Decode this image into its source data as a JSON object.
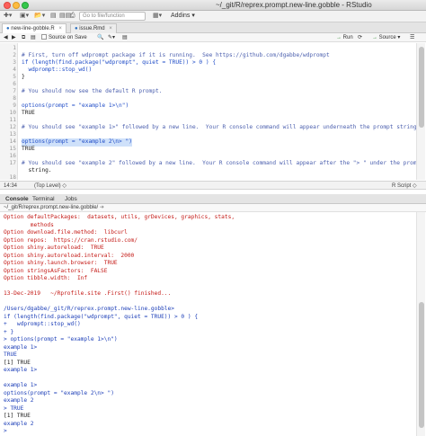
{
  "window": {
    "title": "~/_git/R/reprex.prompt.new-line.gobble - RStudio"
  },
  "main_toolbar": {
    "goto_placeholder": "Go to file/function",
    "addins_label": "Addins"
  },
  "editor": {
    "tabs": [
      {
        "label": "new-line-gobble.R",
        "active": true
      },
      {
        "label": "issue.Rmd",
        "active": false
      }
    ],
    "toolbar": {
      "source_on_save": "Source on Save",
      "run": "Run",
      "source": "Source"
    },
    "lines": [
      {
        "num": "1",
        "text": ""
      },
      {
        "num": "2",
        "text": "# First, turn off wdprompt package if it is running.  See https://github.com/dgabbe/wdprompt"
      },
      {
        "num": "3",
        "text": "if (length(find.package(\"wdprompt\", quiet = TRUE)) > 0 ) {"
      },
      {
        "num": "4",
        "text": "  wdprompt::stop_wd()"
      },
      {
        "num": "5",
        "text": "}"
      },
      {
        "num": "6",
        "text": ""
      },
      {
        "num": "7",
        "text": "# You should now see the default R prompt."
      },
      {
        "num": "8",
        "text": ""
      },
      {
        "num": "9",
        "text": "options(prompt = \"example 1>\\n\")"
      },
      {
        "num": "10",
        "text": "TRUE"
      },
      {
        "num": "11",
        "text": ""
      },
      {
        "num": "12",
        "text": "# You should see \"example 1>\" followed by a new line.  Your R console command will appear underneath the prompt string."
      },
      {
        "num": "13",
        "text": ""
      },
      {
        "num": "14",
        "text": "options(prompt = \"example 2\\n> \")"
      },
      {
        "num": "15",
        "text": "TRUE"
      },
      {
        "num": "16",
        "text": ""
      },
      {
        "num": "17",
        "text": "# You should see \"example 2\" followed by a new line.  Your R console command will appear after the \"> \" under the prompt"
      },
      {
        "num": "",
        "text": "  string."
      },
      {
        "num": "18",
        "text": ""
      }
    ],
    "status": {
      "position": "14:34",
      "scope": "(Top Level)",
      "filetype": "R Script"
    }
  },
  "console_panel": {
    "tabs": [
      {
        "label": "Console",
        "active": true
      },
      {
        "label": "Terminal",
        "active": false
      },
      {
        "label": "Jobs",
        "active": false
      }
    ],
    "path": "~/_git/R/reprex.prompt.new-line.gobble/",
    "lines": [
      {
        "text": "Option defaultPackages:  datasets, utils, grDevices, graphics, stats,",
        "color": "red"
      },
      {
        "text": "        methods",
        "color": "red"
      },
      {
        "text": "Option download.file.method:  libcurl",
        "color": "red"
      },
      {
        "text": "Option repos:  https://cran.rstudio.com/",
        "color": "red"
      },
      {
        "text": "Option shiny.autoreload:  TRUE",
        "color": "red"
      },
      {
        "text": "Option shiny.autoreload.interval:  2000",
        "color": "red"
      },
      {
        "text": "Option shiny.launch.browser:  TRUE",
        "color": "red"
      },
      {
        "text": "Option stringsAsFactors:  FALSE",
        "color": "red"
      },
      {
        "text": "Option tibble.width:  Inf",
        "color": "red"
      },
      {
        "text": "",
        "color": "black"
      },
      {
        "text": "13-Dec-2019   ~/Rprofile.site .First() finished...",
        "color": "red"
      },
      {
        "text": "",
        "color": "black"
      },
      {
        "text": "/Users/dgabbe/_git/R/reprex.prompt.new-line.gobble>",
        "color": "blue"
      },
      {
        "text": "if (length(find.package(\"wdprompt\", quiet = TRUE)) > 0 ) {",
        "color": "blue"
      },
      {
        "text": "+   wdprompt::stop_wd()",
        "color": "blue"
      },
      {
        "text": "+ }",
        "color": "blue"
      },
      {
        "text": "> options(prompt = \"example 1>\\n\")",
        "color": "blue"
      },
      {
        "text": "example 1>",
        "color": "blue"
      },
      {
        "text": "TRUE",
        "color": "blue"
      },
      {
        "text": "[1] TRUE",
        "color": "black"
      },
      {
        "text": "example 1>",
        "color": "blue"
      },
      {
        "text": "",
        "color": "black"
      },
      {
        "text": "example 1>",
        "color": "blue"
      },
      {
        "text": "options(prompt = \"example 2\\n> \")",
        "color": "blue"
      },
      {
        "text": "example 2",
        "color": "blue"
      },
      {
        "text": "> TRUE",
        "color": "blue"
      },
      {
        "text": "[1] TRUE",
        "color": "black"
      },
      {
        "text": "example 2",
        "color": "blue"
      },
      {
        "text": ">",
        "color": "blue"
      }
    ]
  }
}
